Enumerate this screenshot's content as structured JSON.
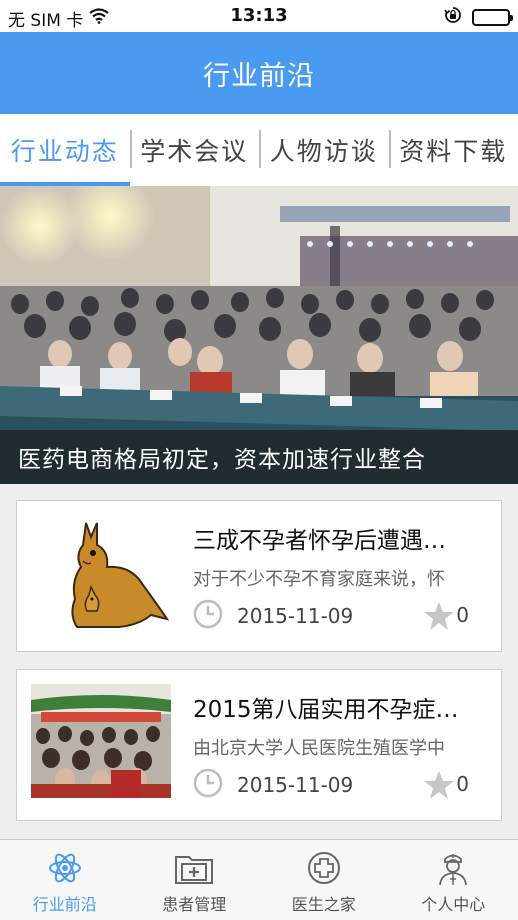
{
  "status": {
    "carrier": "无 SIM 卡",
    "time": "13:13"
  },
  "nav": {
    "title": "行业前沿"
  },
  "tabs": [
    {
      "label": "行业动态"
    },
    {
      "label": "学术会议"
    },
    {
      "label": "人物访谈"
    },
    {
      "label": "资料下载"
    }
  ],
  "banner": {
    "caption": "医药电商格局初定，资本加速行业整合"
  },
  "articles": [
    {
      "title": "三成不孕者怀孕后遭遇…",
      "summary": "对于不少不孕不育家庭来说，怀",
      "date": "2015-11-09",
      "favorites": "0"
    },
    {
      "title": "2015第八届实用不孕症…",
      "summary": "由北京大学人民医院生殖医学中",
      "date": "2015-11-09",
      "favorites": "0"
    }
  ],
  "tabbar": [
    {
      "label": "行业前沿",
      "icon": "atom-icon"
    },
    {
      "label": "患者管理",
      "icon": "medical-folder-icon"
    },
    {
      "label": "医生之家",
      "icon": "medical-cross-circle-icon"
    },
    {
      "label": "个人中心",
      "icon": "doctor-icon"
    }
  ],
  "colors": {
    "accent": "#4a9af1",
    "nav_bg": "#4a9af1",
    "inactive": "#555555",
    "icon_gray": "#bdbdbd"
  }
}
